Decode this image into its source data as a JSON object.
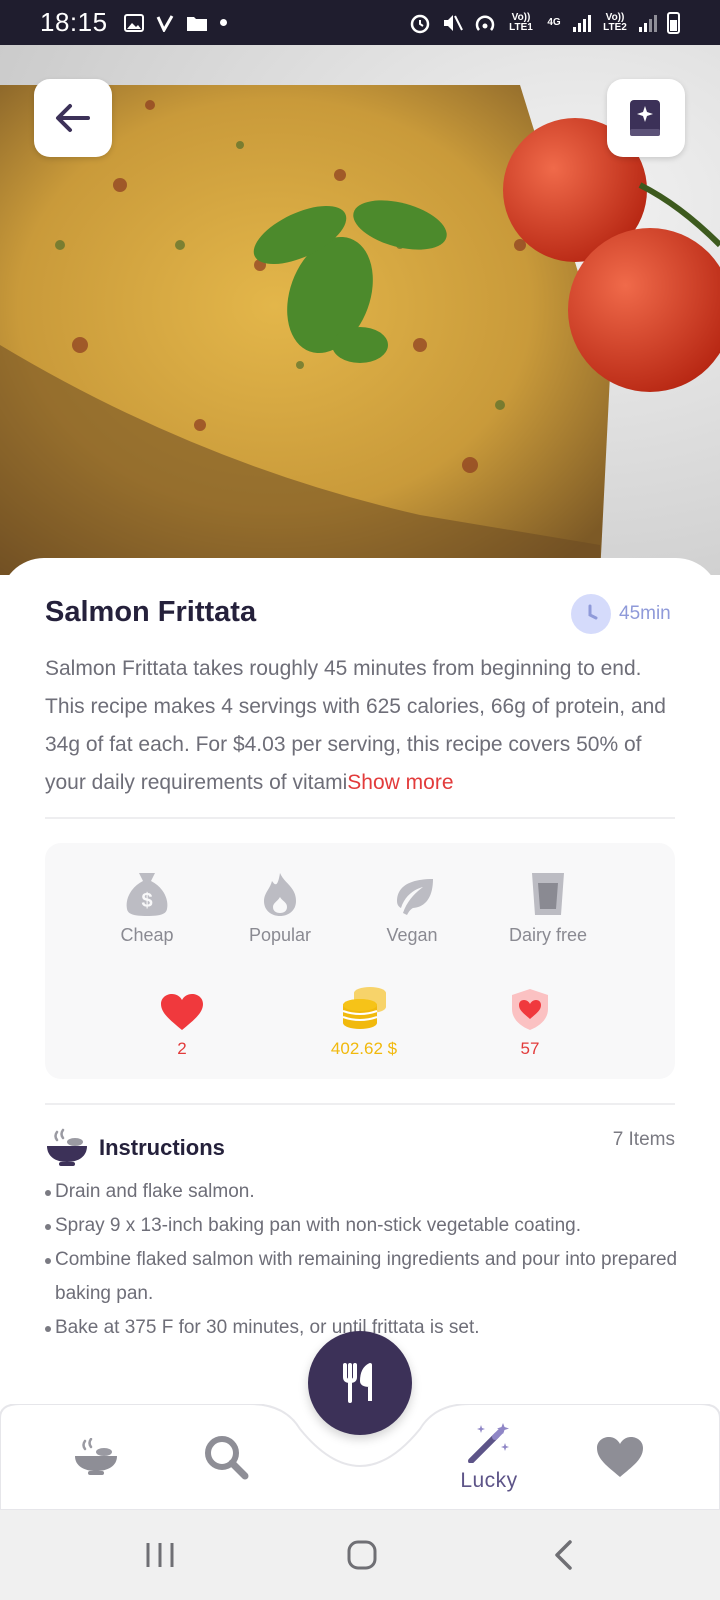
{
  "status_bar": {
    "time": "18:15",
    "network_labels": [
      "Vo)) LTE1",
      "4G",
      "Vo)) LTE2"
    ]
  },
  "recipe": {
    "title": "Salmon Frittata",
    "duration": "45min",
    "description": "Salmon Frittata takes roughly 45 minutes from beginning to end. This recipe makes 4 servings with 625 calories, 66g of protein, and 34g of fat each. For $4.03 per serving, this recipe covers 50% of your daily requirements of vitami",
    "show_more": "Show more"
  },
  "tags": [
    {
      "label": "Cheap",
      "icon": "money-bag-icon"
    },
    {
      "label": "Popular",
      "icon": "flame-icon"
    },
    {
      "label": "Vegan",
      "icon": "leaf-icon"
    },
    {
      "label": "Dairy free",
      "icon": "glass-icon"
    }
  ],
  "stats": {
    "likes": "2",
    "price": "402.62 $",
    "health_score": "57"
  },
  "instructions": {
    "title": "Instructions",
    "count": "7 Items",
    "steps": [
      "Drain and flake salmon.",
      "Spray 9 x 13-inch baking pan with non-stick vegetable coating.",
      "Combine flaked salmon with remaining ingredients and pour into prepared baking pan.",
      "Bake at 375 F for 30 minutes, or until frittata is set."
    ]
  },
  "bottom_nav": {
    "lucky_label": "Lucky"
  },
  "colors": {
    "primary": "#3c3158",
    "accent_red": "#e23b3b",
    "gold": "#f1b90d",
    "time_blue": "#8f9ad9"
  }
}
